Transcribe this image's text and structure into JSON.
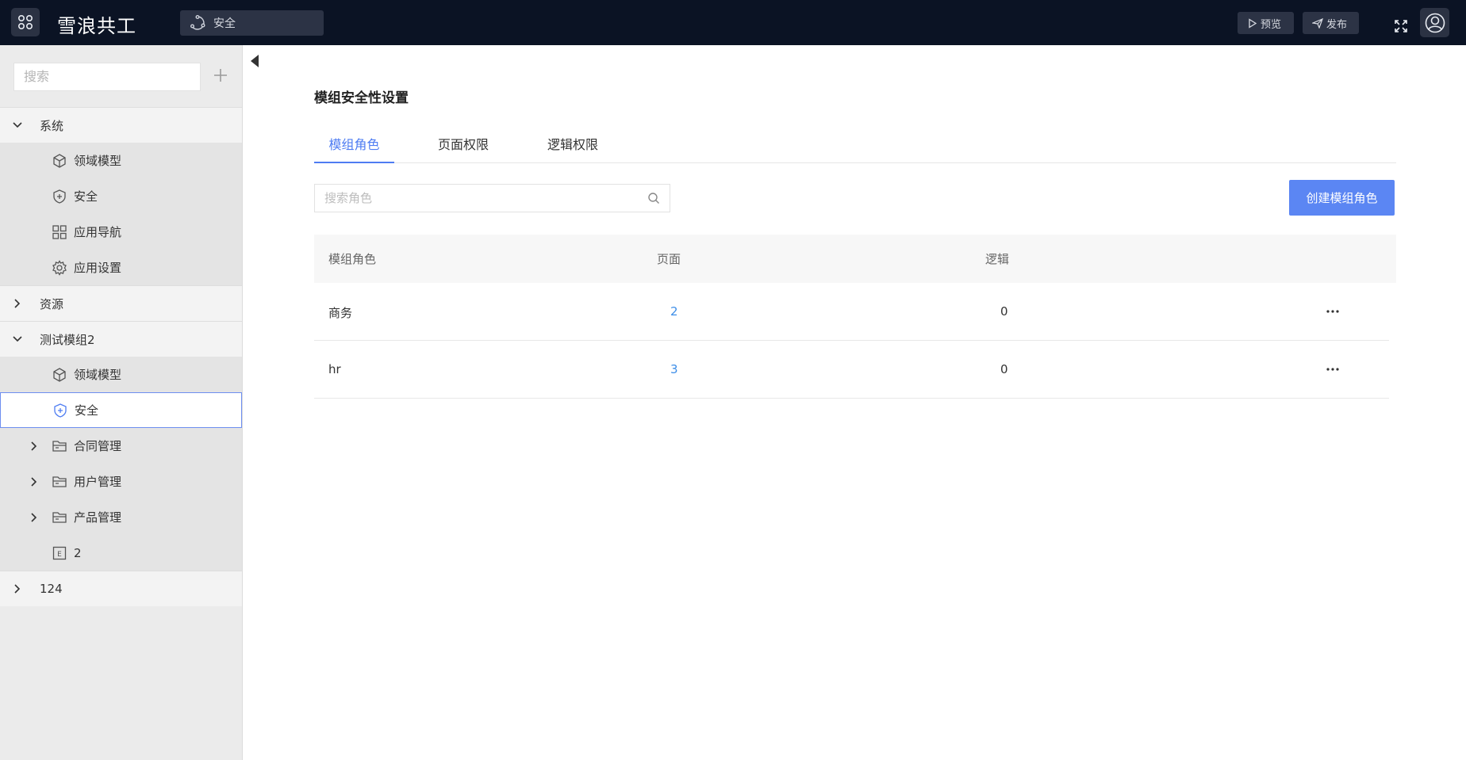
{
  "header": {
    "app_title": "雪浪共工",
    "module_label": "安全",
    "preview_label": "预览",
    "publish_label": "发布"
  },
  "sidebar": {
    "search_placeholder": "搜索",
    "items": [
      {
        "label": "系统"
      },
      {
        "label": "领域模型"
      },
      {
        "label": "安全"
      },
      {
        "label": "应用导航"
      },
      {
        "label": "应用设置"
      },
      {
        "label": "资源"
      },
      {
        "label": "测试模组2"
      },
      {
        "label": "领域模型"
      },
      {
        "label": "安全"
      },
      {
        "label": "合同管理"
      },
      {
        "label": "用户管理"
      },
      {
        "label": "产品管理"
      },
      {
        "label": "2"
      },
      {
        "label": "124"
      }
    ]
  },
  "main": {
    "title": "模组安全性设置",
    "tabs": [
      {
        "label": "模组角色"
      },
      {
        "label": "页面权限"
      },
      {
        "label": "逻辑权限"
      }
    ],
    "search_placeholder": "搜索角色",
    "create_button": "创建模组角色",
    "table": {
      "columns": [
        "模组角色",
        "页面",
        "逻辑"
      ],
      "rows": [
        {
          "role": "商务",
          "pages": "2",
          "logic": "0"
        },
        {
          "role": "hr",
          "pages": "3",
          "logic": "0"
        }
      ]
    }
  },
  "colors": {
    "topbar": "#0b1324",
    "accent": "#5b86f3",
    "link": "#3d8ee8"
  }
}
